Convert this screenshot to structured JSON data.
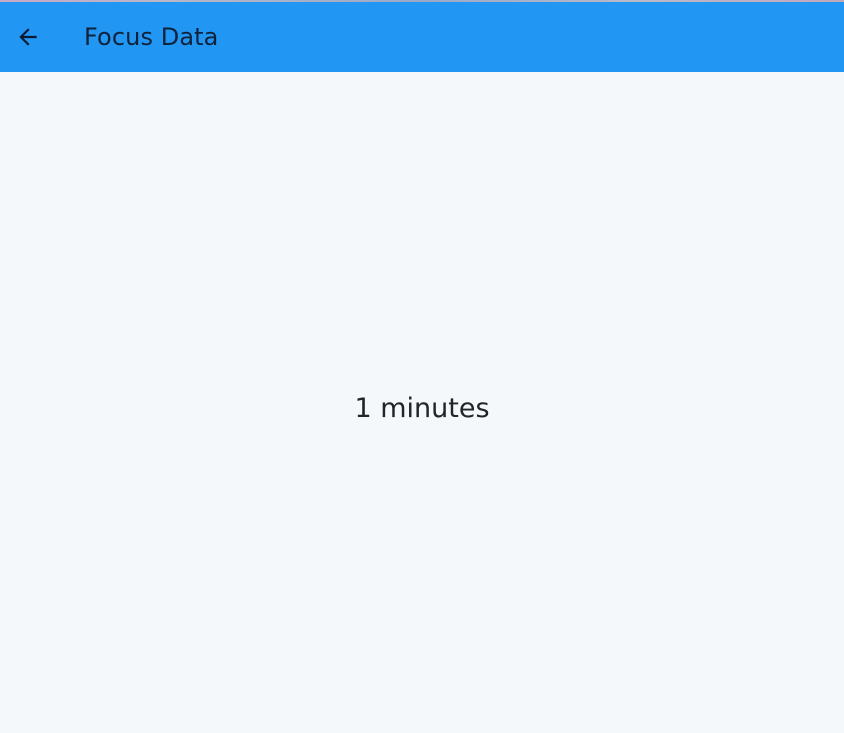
{
  "appbar": {
    "title": "Focus Data",
    "back_icon": "arrow-left-icon",
    "background_color": "#2196f3",
    "title_color": "#10213a"
  },
  "main": {
    "focus_time_text": "1 minutes",
    "background_color": "#f4f8fb",
    "text_color": "#222426"
  }
}
